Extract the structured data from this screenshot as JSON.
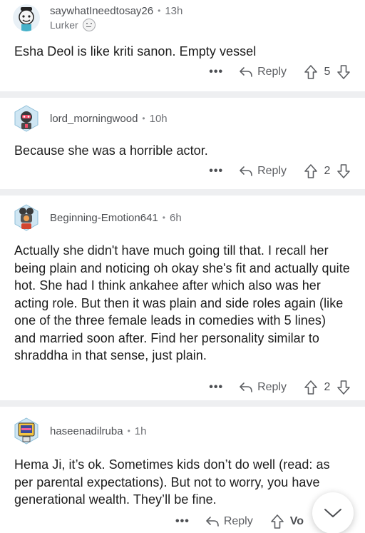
{
  "comments": [
    {
      "username": "saywhatIneedtosay26",
      "time": "13h",
      "flair": "Lurker",
      "text": "Esha Deol is like kriti sanon. Empty vessel",
      "reply_label": "Reply",
      "votes": "5"
    },
    {
      "username": "lord_morningwood",
      "time": "10h",
      "text": "Because she was a horrible actor.",
      "reply_label": "Reply",
      "votes": "2"
    },
    {
      "username": "Beginning-Emotion641",
      "time": "6h",
      "text": "Actually she didn't have much going till that. I recall her being plain and noticing oh okay she's fit and actually quite hot. She had I think ankahee after which also was her acting role. But then it was plain and side roles again (like one of the three female leads in comedies with 5 lines) and married soon after. Find her personality similar to shraddha in that sense, just plain.",
      "reply_label": "Reply",
      "votes": "2"
    },
    {
      "username": "haseenadilruba",
      "time": "1h",
      "text": "Hema Ji, it’s ok. Sometimes kids don’t do well (read: as per parental expectations). But not to worry, you have generational wealth. They’ll be fine.",
      "reply_label": "Reply",
      "vote_label": "Vo"
    }
  ],
  "icons": {
    "more": "more-options-icon",
    "reply": "reply-arrow-icon",
    "upvote": "upvote-arrow-icon",
    "downvote": "downvote-arrow-icon",
    "scroll": "chevron-down-icon"
  },
  "separator_dots": "•",
  "more_glyph": "•••",
  "colors": {
    "separator": "#eeeff1",
    "meta_text": "#4c4e52",
    "body_text": "#1c1c1c"
  }
}
